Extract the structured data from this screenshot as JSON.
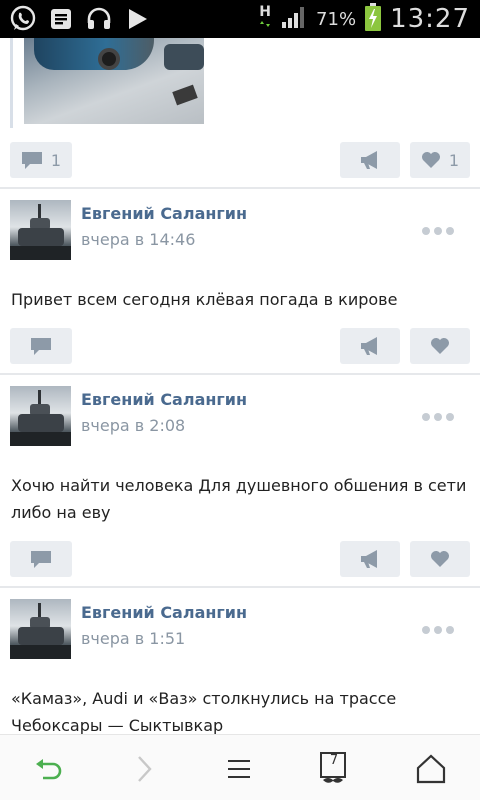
{
  "status_bar": {
    "network_type": "H",
    "battery_percent": "71%",
    "time": "13:27",
    "icons": [
      "whatsapp-icon",
      "messages-icon",
      "headphones-icon",
      "play-icon",
      "network-h-icon",
      "signal-icon",
      "battery-icon"
    ]
  },
  "feed": {
    "first_post_actions": {
      "comments": "1",
      "likes": "1"
    },
    "posts": [
      {
        "author": "Евгений Салангин",
        "time": "вчера в 14:46",
        "text": "Привет всем сегодня клёвая погада в кирове"
      },
      {
        "author": "Евгений Салангин",
        "time": "вчера в 2:08",
        "text": "Хочю найти человека Для душевного обшения в сети либо на еву"
      },
      {
        "author": "Евгений Салангин",
        "time": "вчера в 1:51",
        "text": "«Камаз», Audi и «Ваз» столкнулись на трассе Чебоксары — Сыктывкар"
      }
    ]
  },
  "bottom_nav": {
    "items": [
      "back-icon",
      "forward-icon",
      "menu-icon",
      "tabs-icon",
      "home-icon"
    ],
    "tab_count": "7"
  },
  "colors": {
    "accent_name": "#4a6a8f",
    "button_bg": "#eaedf1",
    "icon_grey": "#8d9aa8",
    "back_green": "#4caf50"
  }
}
